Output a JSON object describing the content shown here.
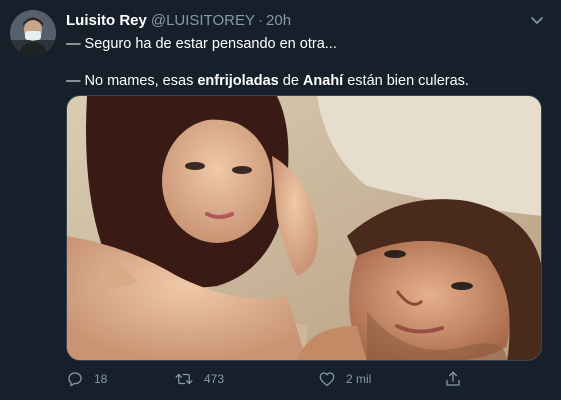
{
  "tweet": {
    "display_name": "Luisito Rey",
    "handle": "@LUISITOREY",
    "separator": "·",
    "time": "20h",
    "line1": "— Seguro ha de estar pensando en otra...",
    "line2_prefix": "— No mames, esas ",
    "line2_bold1": "enfrijoladas",
    "line2_mid": " de ",
    "line2_bold2": "Anahí",
    "line2_suffix": " están bien culeras."
  },
  "actions": {
    "reply_count": "18",
    "retweet_count": "473",
    "like_count": "2 mil"
  },
  "icons": {
    "menu": "chevron-down-icon",
    "reply": "reply-icon",
    "retweet": "retweet-icon",
    "like": "heart-icon",
    "share": "share-icon"
  },
  "colors": {
    "background": "#15202b",
    "secondary_text": "#8899a6",
    "accent": "#1da1f2"
  }
}
